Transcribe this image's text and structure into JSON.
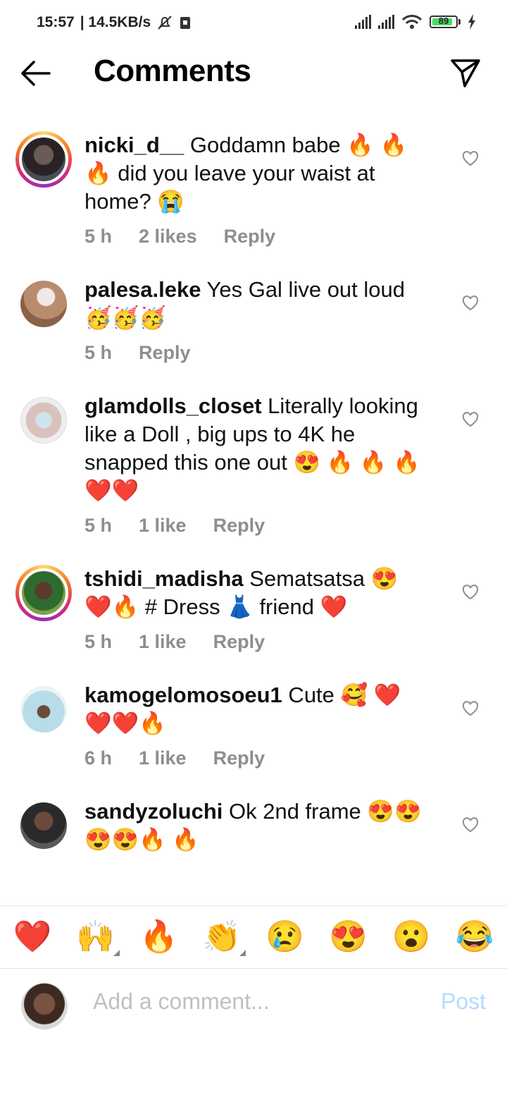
{
  "status_bar": {
    "time": "15:57",
    "speed": "| 14.5KB/s",
    "battery": "89"
  },
  "header": {
    "title": "Comments"
  },
  "comments": [
    {
      "user": "nicki_d__",
      "text": " Goddamn babe 🔥 🔥 🔥  did you leave your waist at home? 😭",
      "time": "5 h",
      "likes": "2 likes",
      "reply": "Reply"
    },
    {
      "user": "palesa.leke",
      "text": " Yes Gal live out loud 🥳🥳🥳",
      "time": "5 h",
      "likes": "",
      "reply": "Reply"
    },
    {
      "user": "glamdolls_closet",
      "text": " Literally looking like a Doll , big ups to 4K he snapped this one out 😍 🔥 🔥 🔥 ❤️❤️",
      "time": "5 h",
      "likes": "1 like",
      "reply": "Reply"
    },
    {
      "user": "tshidi_madisha",
      "text": " Sematsatsa 😍 ❤️🔥  # Dress 👗  friend ❤️",
      "time": "5 h",
      "likes": "1 like",
      "reply": "Reply"
    },
    {
      "user": "kamogelomosoeu1",
      "text": " Cute 🥰 ❤️ ❤️❤️🔥",
      "time": "6 h",
      "likes": "1 like",
      "reply": "Reply"
    },
    {
      "user": "sandyzoluchi",
      "text": " Ok 2nd frame 😍😍 😍😍🔥 🔥",
      "time": "",
      "likes": "",
      "reply": ""
    }
  ],
  "emoji_bar": [
    "❤️",
    "🙌",
    "🔥",
    "👏",
    "😢",
    "😍",
    "😮",
    "😂"
  ],
  "composer": {
    "placeholder": "Add a comment...",
    "post": "Post"
  },
  "colors": {
    "like_heart": "#ed1c24",
    "meta_text": "#8e8e8e",
    "post_disabled": "#b3dbff"
  }
}
